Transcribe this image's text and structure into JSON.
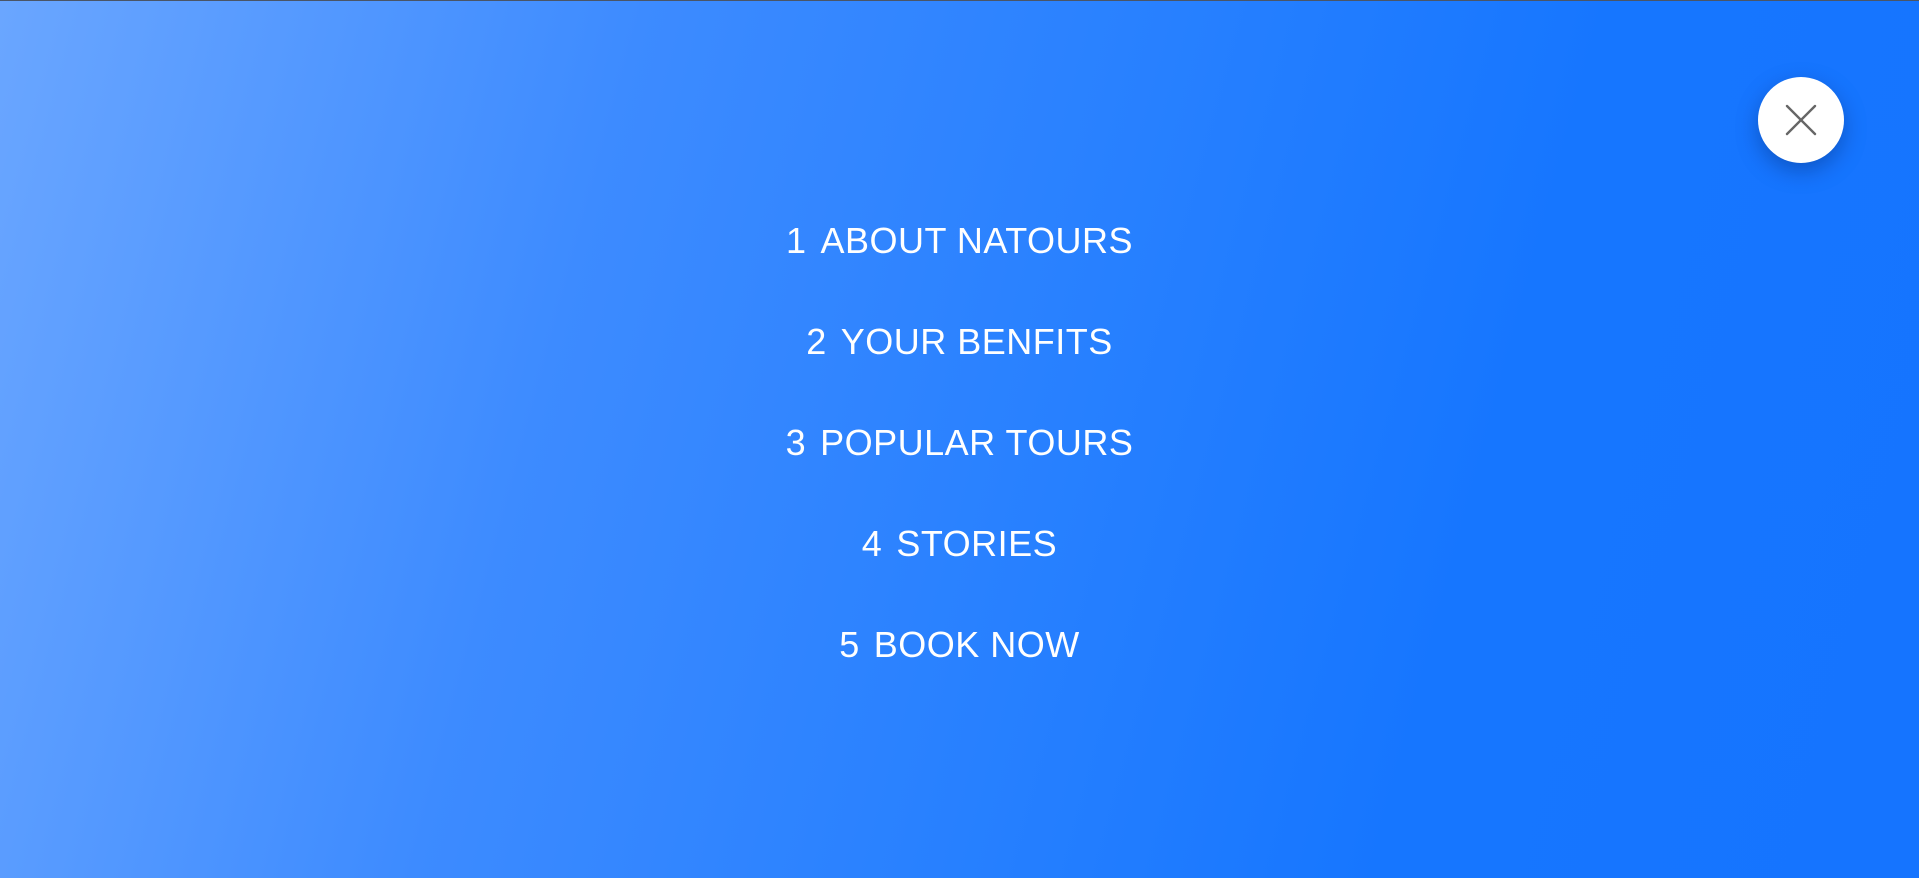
{
  "navigation": {
    "items": [
      {
        "number": "1",
        "label": "ABOUT NATOURS"
      },
      {
        "number": "2",
        "label": "YOUR BENFITS"
      },
      {
        "number": "3",
        "label": "POPULAR TOURS"
      },
      {
        "number": "4",
        "label": "STORIES"
      },
      {
        "number": "5",
        "label": "BOOK NOW"
      }
    ]
  },
  "close_button": {
    "icon": "close-icon"
  },
  "colors": {
    "gradient_light": "#6aa6ff",
    "gradient_dark": "#1574ff",
    "text": "#ffffff",
    "button_bg": "#ffffff",
    "icon": "#666666"
  }
}
